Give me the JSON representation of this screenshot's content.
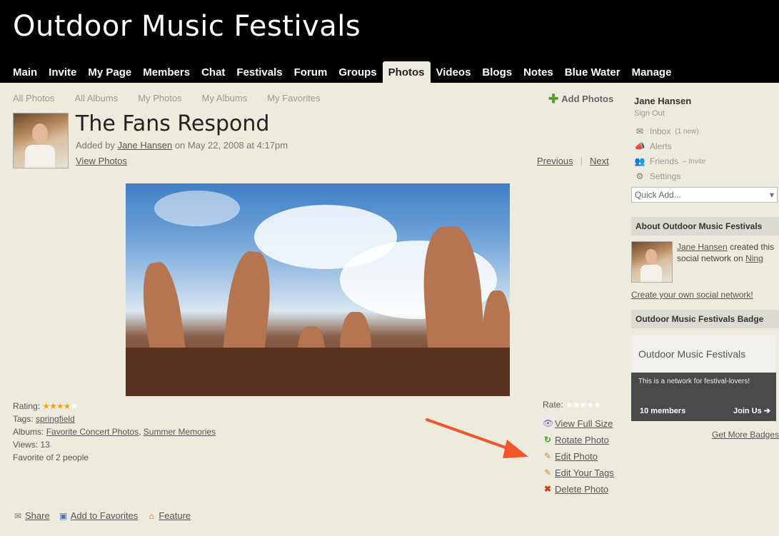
{
  "site": {
    "title": "Outdoor Music Festivals"
  },
  "nav": [
    "Main",
    "Invite",
    "My Page",
    "Members",
    "Chat",
    "Festivals",
    "Forum",
    "Groups",
    "Photos",
    "Videos",
    "Blogs",
    "Notes",
    "Blue Water",
    "Manage"
  ],
  "nav_active": "Photos",
  "subnav": [
    "All Photos",
    "All Albums",
    "My Photos",
    "My Albums",
    "My Favorites"
  ],
  "add_photos": "Add Photos",
  "photo": {
    "title": "The Fans Respond",
    "added_by_prefix": "Added by",
    "author": "Jane Hansen",
    "date": "on May 22, 2008 at 4:17pm",
    "view_photos": "View Photos",
    "previous": "Previous",
    "separator": "|",
    "next": "Next"
  },
  "details": {
    "rating_label": "Rating:",
    "rating_value": 4,
    "rating_max": 5,
    "tags_label": "Tags:",
    "tag": "springfield",
    "albums_label": "Albums:",
    "album1": "Favorite Concert Photos",
    "album_sep": ",",
    "album2": "Summer Memories",
    "views": "Views: 13",
    "favorite": "Favorite of 2 people"
  },
  "rate_label": "Rate:",
  "actions": {
    "view_full_size": "View Full Size",
    "rotate": "Rotate Photo",
    "edit": "Edit Photo",
    "edit_tags": "Edit Your Tags",
    "delete": "Delete Photo"
  },
  "share_bar": {
    "share": "Share",
    "add_favorites": "Add to Favorites",
    "feature": "Feature"
  },
  "sidebar": {
    "user_name": "Jane Hansen",
    "sign_out": "Sign Out",
    "inbox": "Inbox",
    "inbox_count": "(1 new)",
    "alerts": "Alerts",
    "friends": "Friends",
    "friends_invite": "– Invite",
    "settings": "Settings",
    "quick_add": "Quick Add...",
    "about_title": "About Outdoor Music Festivals",
    "creator": "Jane Hansen",
    "created_text": "created this social network on",
    "platform": "Ning",
    "create_own": "Create your own social network!",
    "badge_title": "Outdoor Music Festivals Badge",
    "badge_name": "Outdoor Music Festivals",
    "badge_desc": "This is a network for festival-lovers!",
    "badge_members": "10 members",
    "badge_join": "Join Us",
    "get_more_badges": "Get More Badges"
  },
  "colors": {
    "header_bg": "#000000",
    "page_bg": "#ecebde",
    "accent_arrow": "#f0552c",
    "star": "#f1a21a"
  }
}
